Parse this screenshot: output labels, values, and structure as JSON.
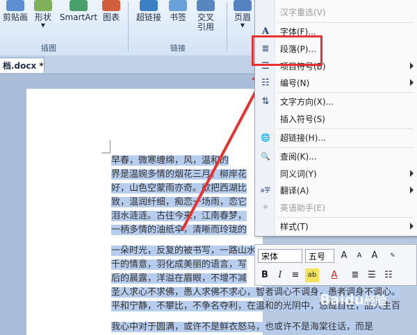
{
  "ribbon": {
    "buttons": [
      {
        "label": "剪贴画",
        "color": "#5b8fd1"
      },
      {
        "label": "形状",
        "color": "#7fb05b"
      },
      {
        "label": "SmartArt",
        "color": "#4aa06b"
      },
      {
        "label": "图表",
        "color": "#d25f3c"
      },
      {
        "label": "超链接",
        "color": "#3c7fc4"
      },
      {
        "label": "书签",
        "color": "#6ba1d9"
      },
      {
        "label": "交叉\n引用",
        "color": "#5a86c0"
      },
      {
        "label": "页眉",
        "color": "#5582c1"
      }
    ],
    "groups": {
      "illustrations": "插图",
      "links": "链接"
    }
  },
  "document": {
    "tab_title": "档.docx *",
    "paragraphs": [
      "    早春，微寒缠绵，风，温和的",
      "界是温婉多情的烟花三月。柳岸花",
      "好，山色空蒙雨亦奇。欲把西湖比",
      "致，温润纤细，痴恋一场雨，恋它",
      "泪水涟涟。古往今来，江南春梦，",
      "一柄多情的油纸伞，清晰而玲珑的",
      "",
      "        一朵时光，反复的被书写，一路山水，春意微醺，写满光阴的",
      "千的情意，羽化成美丽的语言，写",
      "后的晨露，洋溢在眉眼，不增不减",
      "圣人求心不求佛，愚人求佛不求心，智者调心不调身，愚者调身不调心。",
      "平和宁静，不攀比，不争名夺利，在温和的光阴中，悠哉自在，品人生百",
      "",
      "        我心中对于圆满，或许不是鲜衣怒马，也或许不是海棠往话，而是"
    ]
  },
  "context_menu": {
    "items": [
      {
        "label": "汉字重选(V)",
        "icon": "",
        "disabled": true,
        "submenu": false
      },
      {
        "label": "字体(F)...",
        "icon": "font-icon",
        "glyph": "A",
        "disabled": false,
        "submenu": false
      },
      {
        "label": "段落(P)...",
        "icon": "paragraph-icon",
        "glyph": "≣",
        "disabled": false,
        "submenu": false
      },
      {
        "label": "项目符号(B)",
        "icon": "bullets-icon",
        "glyph": "☰",
        "disabled": false,
        "submenu": true
      },
      {
        "label": "编号(N)",
        "icon": "numbering-icon",
        "glyph": "☷",
        "disabled": false,
        "submenu": true
      },
      {
        "label": "文字方向(X)...",
        "icon": "text-direction-icon",
        "glyph": "⇅",
        "disabled": false,
        "submenu": false
      },
      {
        "label": "插入符号(S)",
        "icon": "",
        "disabled": false,
        "submenu": false
      },
      {
        "label": "超链接(H)...",
        "icon": "hyperlink-icon",
        "glyph": "🌐",
        "disabled": false,
        "submenu": false
      },
      {
        "label": "查阅(K)...",
        "icon": "research-icon",
        "glyph": "🔍",
        "disabled": false,
        "submenu": false
      },
      {
        "label": "同义词(Y)",
        "icon": "",
        "disabled": false,
        "submenu": true
      },
      {
        "label": "翻译(A)",
        "icon": "translate-icon",
        "glyph": "a字",
        "disabled": false,
        "submenu": true
      },
      {
        "label": "英语助手(E)",
        "icon": "english-assistant-icon",
        "glyph": "✦",
        "disabled": true,
        "submenu": false
      },
      {
        "label": "样式(T)",
        "icon": "",
        "disabled": false,
        "submenu": true
      }
    ]
  },
  "mini_toolbar": {
    "font": "宋体",
    "size": "五号",
    "row2": [
      "B",
      "I",
      "≡",
      "ab",
      "A",
      "≣",
      "☰",
      "☷"
    ]
  },
  "watermark": {
    "text": "Baidu",
    "sub": "经验"
  },
  "colors": {
    "highlight": "#b7cdee",
    "annotation": "#e8312e"
  }
}
